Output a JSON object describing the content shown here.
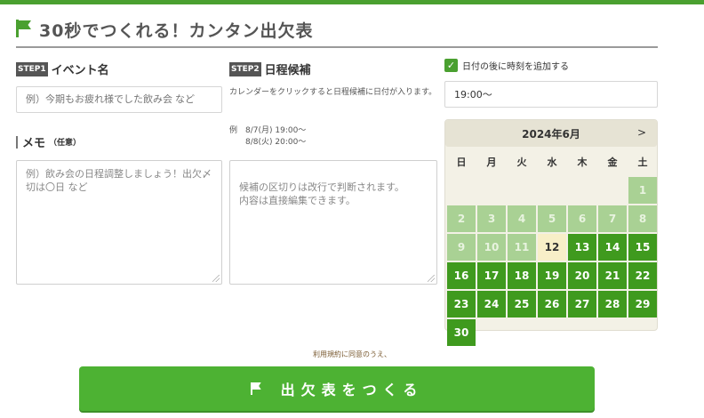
{
  "header": {
    "title": "30秒でつくれる！カンタン出欠表"
  },
  "step1": {
    "badge": "STEP1",
    "label": "イベント名",
    "placeholder": "例）今期もお疲れ様でした飲み会 など"
  },
  "memo": {
    "label": "メモ",
    "sub": "（任意）",
    "placeholder": "例）飲み会の日程調整しましょう！出欠〆切は〇日 など"
  },
  "step2": {
    "badge": "STEP2",
    "label": "日程候補",
    "help": "カレンダーをクリックすると日程候補に日付が入ります。",
    "example_line1": "例　8/7(月) 19:00～",
    "example_line2": "8/8(火) 20:00～",
    "placeholder": "候補の区切りは改行で判断されます。\n内容は直接編集できます。"
  },
  "time_option": {
    "checkbox_label": "日付の後に時刻を追加する",
    "checked": true,
    "time_value": "19:00～"
  },
  "calendar": {
    "month_label": "2024年6月",
    "next_label": ">",
    "weekdays": [
      "日",
      "月",
      "火",
      "水",
      "木",
      "金",
      "土"
    ],
    "first_weekday_index": 6,
    "days_in_month": 30,
    "today": 12,
    "past_color": "#a9d194",
    "future_color": "#3f9a1e",
    "today_color": "#f8efc8"
  },
  "footer": {
    "terms": "利用規約に同意のうえ、",
    "submit_label": "出欠表をつくる"
  },
  "colors": {
    "accent": "#4aa030",
    "button": "#4db233"
  }
}
